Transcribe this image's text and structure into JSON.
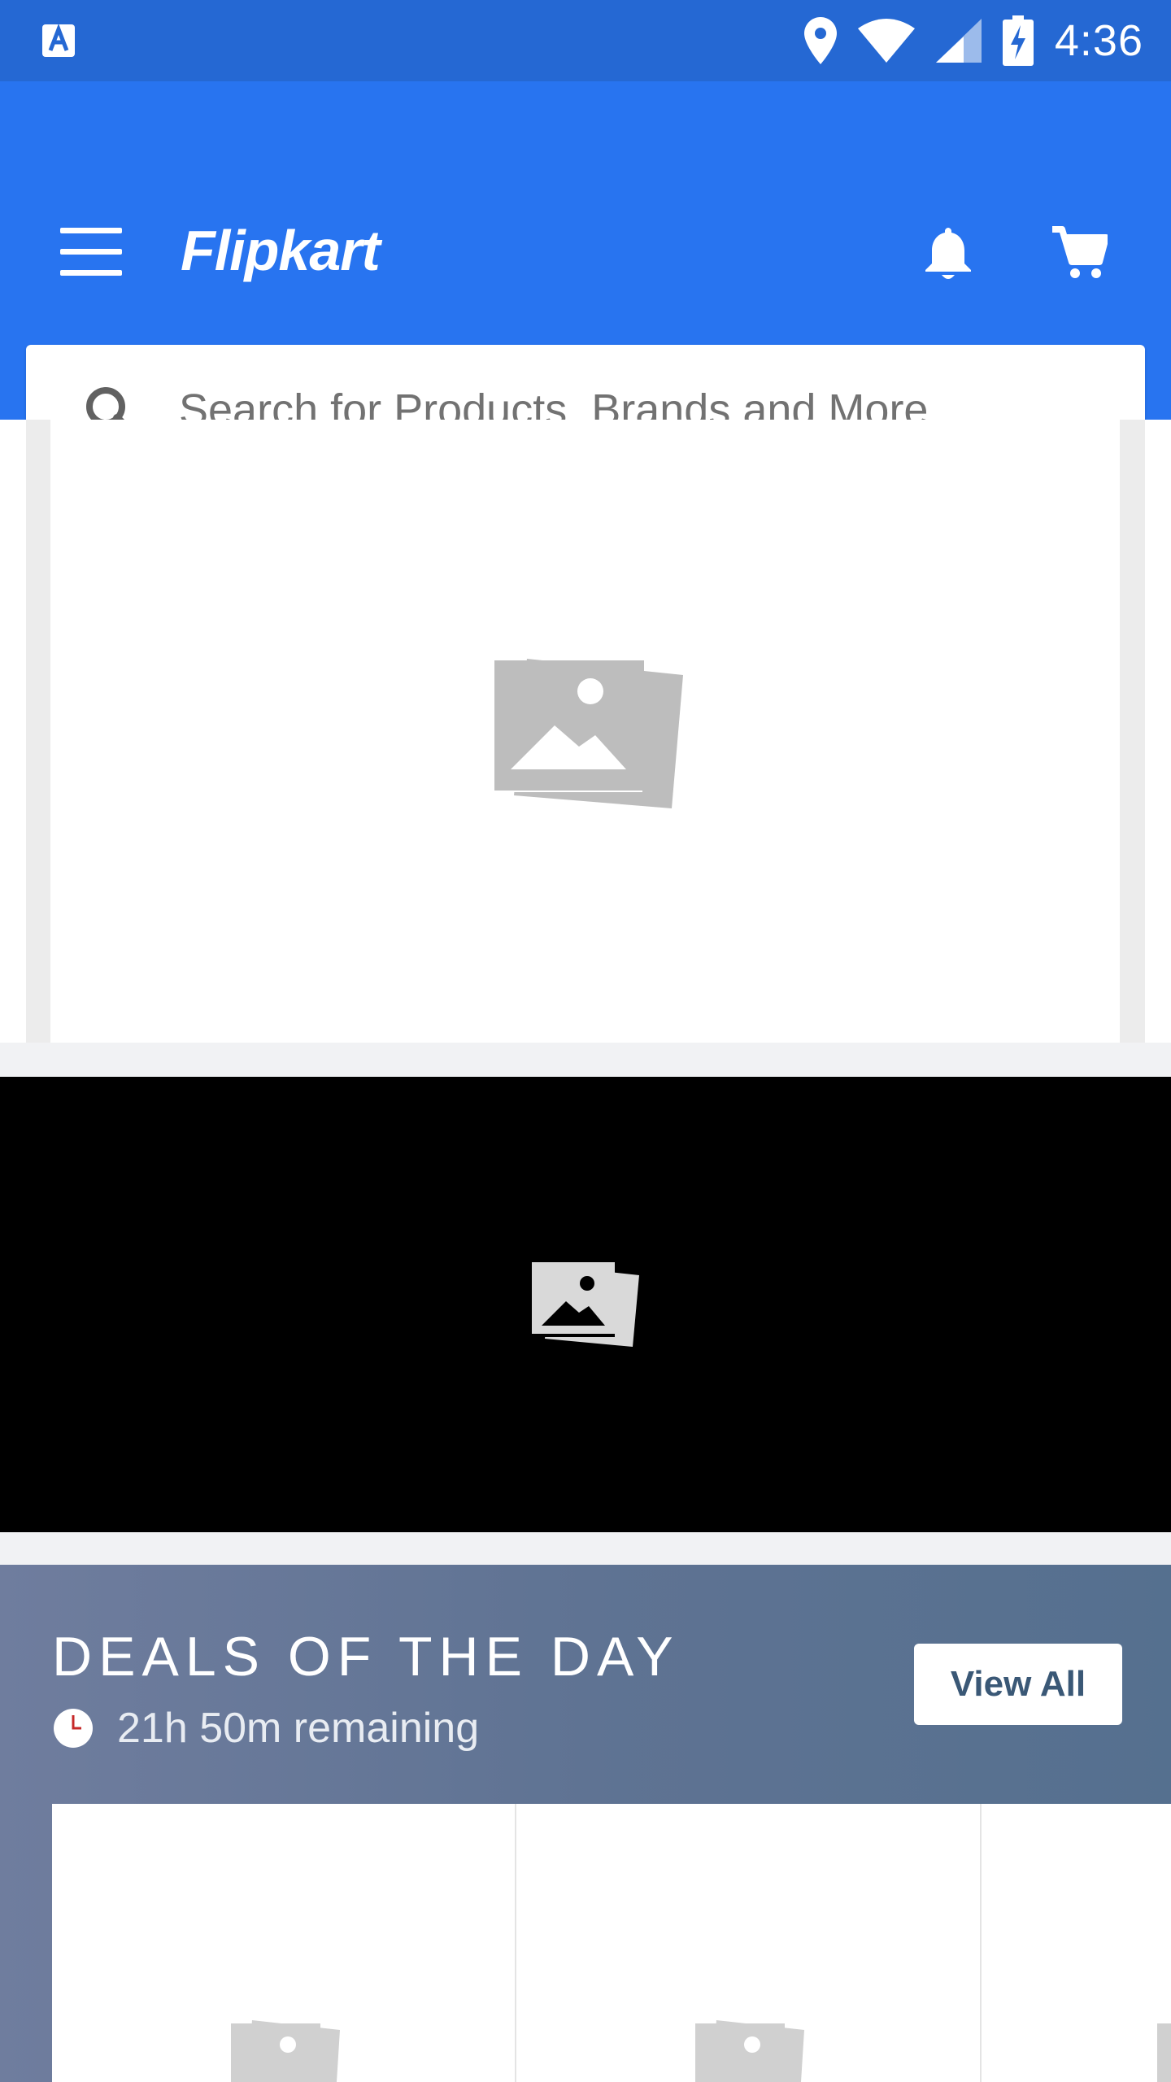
{
  "status_bar": {
    "time": "4:36",
    "icons": [
      "accessibility-a-icon",
      "location-pin-icon",
      "wifi-icon",
      "cell-signal-icon",
      "battery-charging-icon"
    ]
  },
  "app_bar": {
    "brand": "Flipkart",
    "menu_icon": "hamburger-menu-icon",
    "notification_icon": "bell-icon",
    "cart_icon": "shopping-cart-icon",
    "background": "#2874f0"
  },
  "search": {
    "placeholder": "Search for Products, Brands and More",
    "icon": "search-icon"
  },
  "banners": {
    "main_banner_icon": "image-placeholder-icon",
    "video_banner_icon": "image-placeholder-icon"
  },
  "deals": {
    "title": "DEALS OF THE DAY",
    "timer_text": "21h 50m remaining",
    "timer_icon": "clock-icon",
    "view_all_label": "View All"
  },
  "colors": {
    "status_bar": "#2568d3",
    "brand_blue": "#2874f0",
    "deals_button_text": "#3a5876",
    "placeholder_gray": "#bdbdbd"
  }
}
